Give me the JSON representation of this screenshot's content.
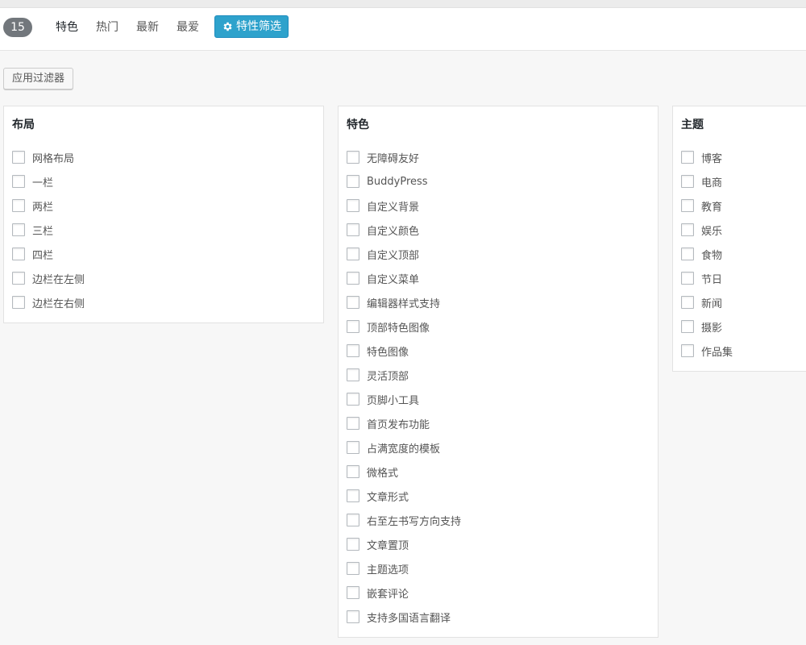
{
  "filter_bar": {
    "count": "15",
    "links": [
      "特色",
      "热门",
      "最新",
      "最爱"
    ],
    "feature_filter_label": "特性筛选"
  },
  "apply_button": "应用过滤器",
  "groups": [
    {
      "title": "布局",
      "options": [
        "网格布局",
        "一栏",
        "两栏",
        "三栏",
        "四栏",
        "边栏在左侧",
        "边栏在右侧"
      ]
    },
    {
      "title": "特色",
      "options": [
        "无障碍友好",
        "BuddyPress",
        "自定义背景",
        "自定义颜色",
        "自定义顶部",
        "自定义菜单",
        "编辑器样式支持",
        "顶部特色图像",
        "特色图像",
        "灵活顶部",
        "页脚小工具",
        "首页发布功能",
        "占满宽度的模板",
        "微格式",
        "文章形式",
        "右至左书写方向支持",
        "文章置顶",
        "主题选项",
        "嵌套评论",
        "支持多国语言翻译"
      ]
    },
    {
      "title": "主题",
      "options": [
        "博客",
        "电商",
        "教育",
        "娱乐",
        "食物",
        "节日",
        "新闻",
        "摄影",
        "作品集"
      ]
    }
  ],
  "colors": {
    "accent": "#2ea2cc",
    "badge": "#72777c"
  },
  "icons": {
    "feature_filter": "gear-icon"
  }
}
